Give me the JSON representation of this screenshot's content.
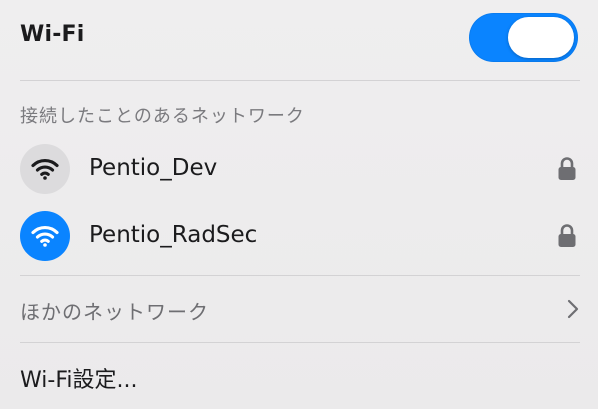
{
  "header": {
    "title": "Wi-Fi",
    "toggle_on": true,
    "toggle_color": "#0a84ff"
  },
  "known_networks": {
    "title": "接続したことのあるネットワーク",
    "items": [
      {
        "name": "Pentio_Dev",
        "connected": false,
        "secured": true,
        "icon": "wifi-icon"
      },
      {
        "name": "Pentio_RadSec",
        "connected": true,
        "secured": true,
        "icon": "wifi-icon"
      }
    ]
  },
  "other_networks": {
    "label": "ほかのネットワーク",
    "icon": "chevron-right-icon"
  },
  "settings": {
    "label": "Wi-Fi設定..."
  },
  "colors": {
    "accent": "#0a84ff",
    "inactive_icon_bg": "#dcdbdd"
  }
}
